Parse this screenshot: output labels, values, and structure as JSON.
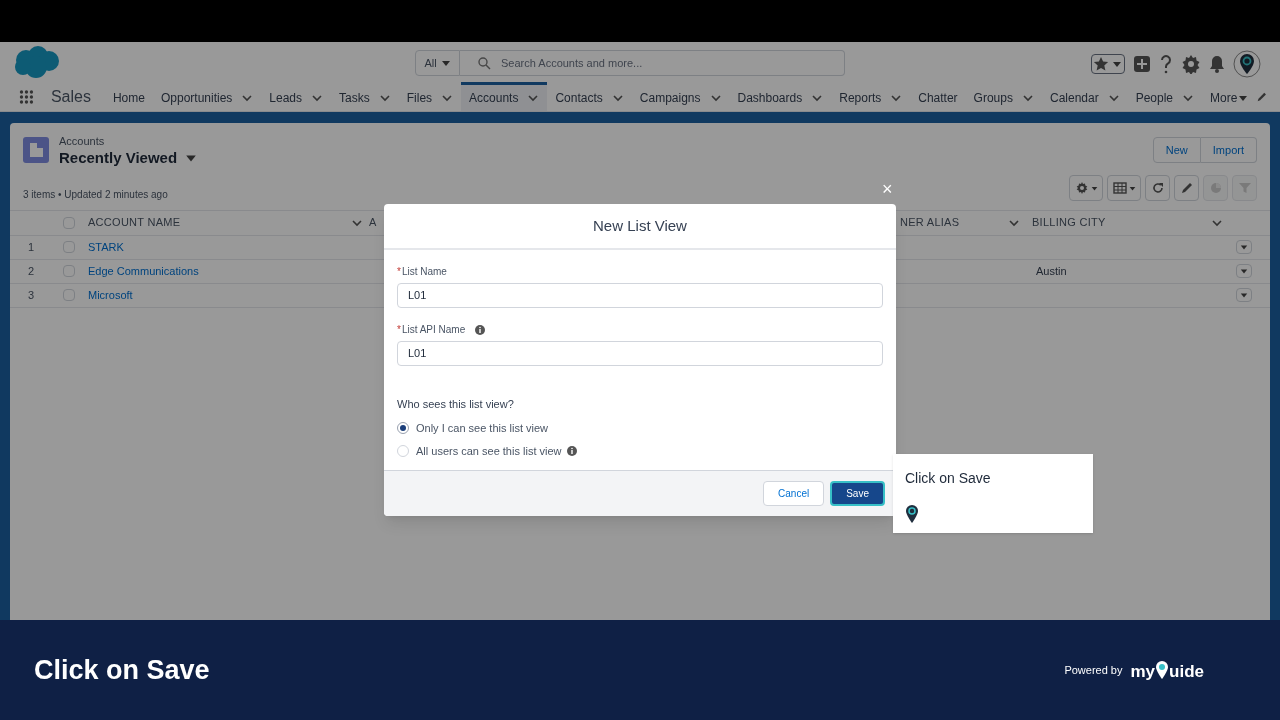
{
  "header": {
    "search_scope": "All",
    "search_placeholder": "Search Accounts and more..."
  },
  "app_name": "Sales",
  "nav": [
    {
      "label": "Home",
      "kind": "plain",
      "selected": false
    },
    {
      "label": "Opportunities",
      "kind": "menu",
      "selected": false
    },
    {
      "label": "Leads",
      "kind": "menu",
      "selected": false
    },
    {
      "label": "Tasks",
      "kind": "menu",
      "selected": false
    },
    {
      "label": "Files",
      "kind": "menu",
      "selected": false
    },
    {
      "label": "Accounts",
      "kind": "menu",
      "selected": true
    },
    {
      "label": "Contacts",
      "kind": "menu",
      "selected": false
    },
    {
      "label": "Campaigns",
      "kind": "menu",
      "selected": false
    },
    {
      "label": "Dashboards",
      "kind": "menu",
      "selected": false
    },
    {
      "label": "Reports",
      "kind": "menu",
      "selected": false
    },
    {
      "label": "Chatter",
      "kind": "plain",
      "selected": false
    },
    {
      "label": "Groups",
      "kind": "menu",
      "selected": false
    },
    {
      "label": "Calendar",
      "kind": "menu",
      "selected": false
    },
    {
      "label": "People",
      "kind": "menu",
      "selected": false
    },
    {
      "label": "More",
      "kind": "more",
      "selected": false
    }
  ],
  "list": {
    "object": "Accounts",
    "view": "Recently Viewed",
    "status": "3 items • Updated 2 minutes ago",
    "actions": [
      "New",
      "Import"
    ],
    "toolbar": [
      {
        "kind": "gear",
        "disabled": false
      },
      {
        "kind": "table",
        "disabled": false
      },
      {
        "kind": "refresh",
        "disabled": false
      },
      {
        "kind": "pencil",
        "disabled": false
      },
      {
        "kind": "chart",
        "disabled": true
      },
      {
        "kind": "filter",
        "disabled": true
      }
    ],
    "select_all_checked": false,
    "columns": [
      "ACCOUNT NAME",
      "A",
      "NER ALIAS",
      "BILLING CITY"
    ],
    "rows": [
      {
        "number": "1",
        "name": "STARK",
        "checked": false
      },
      {
        "number": "2",
        "name": "Edge Communications",
        "billing_city": "Austin",
        "checked": false
      },
      {
        "number": "3",
        "name": "Microsoft",
        "checked": false
      }
    ]
  },
  "modal": {
    "title": "New List View",
    "close": "×",
    "fields": [
      {
        "required_mark": "*",
        "label": "List Name",
        "info": false,
        "value": "L01"
      },
      {
        "required_mark": "*",
        "label": "List API Name",
        "info": true,
        "value": "L01"
      }
    ],
    "visibility_question": "Who sees this list view?",
    "options": [
      {
        "label": "Only I can see this list view",
        "selected": true,
        "info": false
      },
      {
        "label": "All users can see this list view",
        "selected": false,
        "info": true
      }
    ],
    "buttons": [
      {
        "label": "Cancel",
        "kind": "neutral"
      },
      {
        "label": "Save",
        "kind": "brand"
      }
    ]
  },
  "tooltip": {
    "text": "Click on Save"
  },
  "banner": {
    "text": "Click on Save",
    "powered_by": "Powered by",
    "logo_start": "my",
    "logo_end": "uide"
  }
}
